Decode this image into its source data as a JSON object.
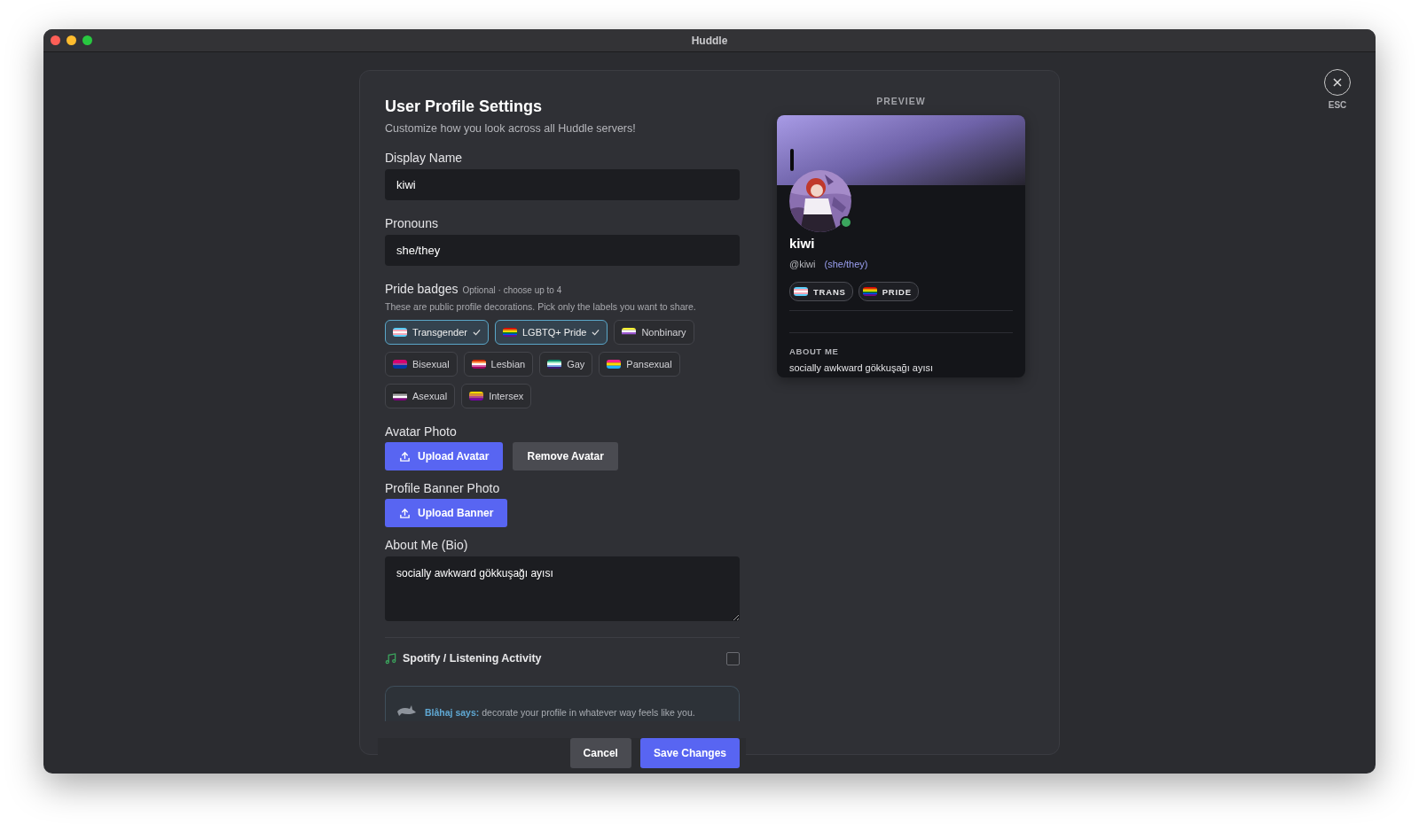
{
  "window": {
    "title": "Huddle"
  },
  "close": {
    "label": "ESC"
  },
  "form": {
    "title": "User Profile Settings",
    "subtitle": "Customize how you look across all Huddle servers!",
    "display_name": {
      "label": "Display Name",
      "value": "kiwi"
    },
    "pronouns": {
      "label": "Pronouns",
      "value": "she/they"
    },
    "badges": {
      "label": "Pride badges",
      "hint": "Optional · choose up to 4",
      "description": "These are public profile decorations. Pick only the labels you want to share.",
      "items": [
        {
          "label": "Transgender",
          "kind": "trans",
          "selected": true
        },
        {
          "label": "LGBTQ+ Pride",
          "kind": "pride",
          "selected": true
        },
        {
          "label": "Nonbinary",
          "kind": "nonbinary",
          "selected": false
        },
        {
          "label": "Bisexual",
          "kind": "bisexual",
          "selected": false
        },
        {
          "label": "Lesbian",
          "kind": "lesbian",
          "selected": false
        },
        {
          "label": "Gay",
          "kind": "gay",
          "selected": false
        },
        {
          "label": "Pansexual",
          "kind": "pansexual",
          "selected": false
        },
        {
          "label": "Asexual",
          "kind": "asexual",
          "selected": false
        },
        {
          "label": "Intersex",
          "kind": "intersex",
          "selected": false
        }
      ]
    },
    "avatar": {
      "label": "Avatar Photo",
      "upload": "Upload Avatar",
      "remove": "Remove Avatar"
    },
    "banner": {
      "label": "Profile Banner Photo",
      "upload": "Upload Banner"
    },
    "bio": {
      "label": "About Me (Bio)",
      "value": "socially awkward gökkuşağı ayısı"
    },
    "spotify": {
      "label": "Spotify / Listening Activity",
      "checked": false
    },
    "tip": "**Blåhaj says:** decorate your profile in whatever way feels like you.",
    "buttons": {
      "cancel": "Cancel",
      "save": "Save Changes"
    }
  },
  "preview": {
    "heading": "PREVIEW",
    "online": true,
    "name": "kiwi",
    "handle": "@kiwi",
    "pronouns": "(she/they)",
    "badges": [
      {
        "label": "TRANS",
        "kind": "trans"
      },
      {
        "label": "PRIDE",
        "kind": "pride"
      }
    ],
    "about_heading": "ABOUT ME",
    "about": "socially awkward gökkuşağı ayısı"
  }
}
